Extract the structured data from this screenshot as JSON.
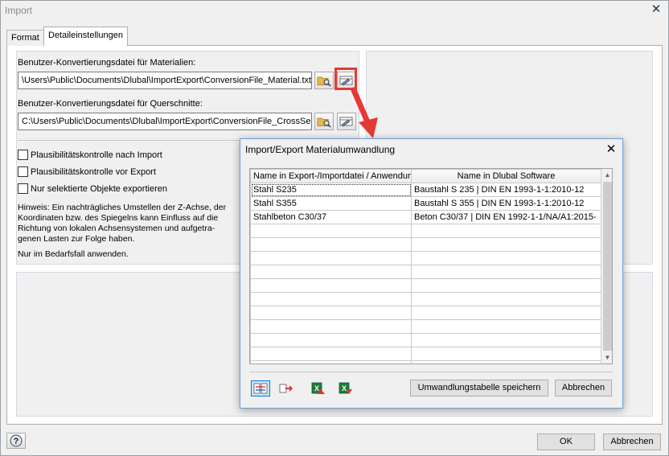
{
  "window": {
    "title": "Import",
    "close_label": "✕"
  },
  "tabs": [
    {
      "label": "Format",
      "active": false
    },
    {
      "label": "Detaileinstellungen",
      "active": true
    }
  ],
  "materials": {
    "label": "Benutzer-Konvertierungsdatei für Materialien:",
    "path": "\\Users\\Public\\Documents\\Dlubal\\ImportExport\\ConversionFile_Material.txt"
  },
  "cross_sections": {
    "label": "Benutzer-Konvertierungsdatei für Querschnitte:",
    "path": "C:\\Users\\Public\\Documents\\Dlubal\\ImportExport\\ConversionFile_CrossSect"
  },
  "options": [
    {
      "label": "Plausibilitätskontrolle nach Import",
      "checked": false
    },
    {
      "label": "Plausibilitätskontrolle vor Export",
      "checked": false
    },
    {
      "label": "Nur selektierte Objekte exportieren",
      "checked": false
    }
  ],
  "hint": {
    "text": "Hinweis: Ein nachträgliches Umstellen der Z-Achse, der Koordinaten bzw. des Spiegelns kann Einfluss auf die Richtung von lokalen Achsensystemen und aufgetra-genen Lasten zur Folge haben.",
    "note": "Nur im Bedarfsfall anwenden."
  },
  "footer": {
    "ok_label": "OK",
    "cancel_label": "Abbrechen"
  },
  "dialog": {
    "title": "Import/Export Materialumwandlung",
    "close_label": "✕",
    "columns": [
      "Name in Export-/Importdatei / Anwendung",
      "Name in Dlubal Software"
    ],
    "rows": [
      [
        "Stahl S235",
        "Baustahl S 235 | DIN EN 1993-1-1:2010-12"
      ],
      [
        "Stahl S355",
        "Baustahl S 355 | DIN EN 1993-1-1:2010-12"
      ],
      [
        "Stahlbeton C30/37",
        "Beton C30/37 | DIN EN 1992-1-1/NA/A1:2015-"
      ]
    ],
    "save_label": "Umwandlungstabelle speichern",
    "cancel_label": "Abbrechen"
  },
  "colors": {
    "highlight": "#e53935",
    "accent": "#0078d7"
  }
}
